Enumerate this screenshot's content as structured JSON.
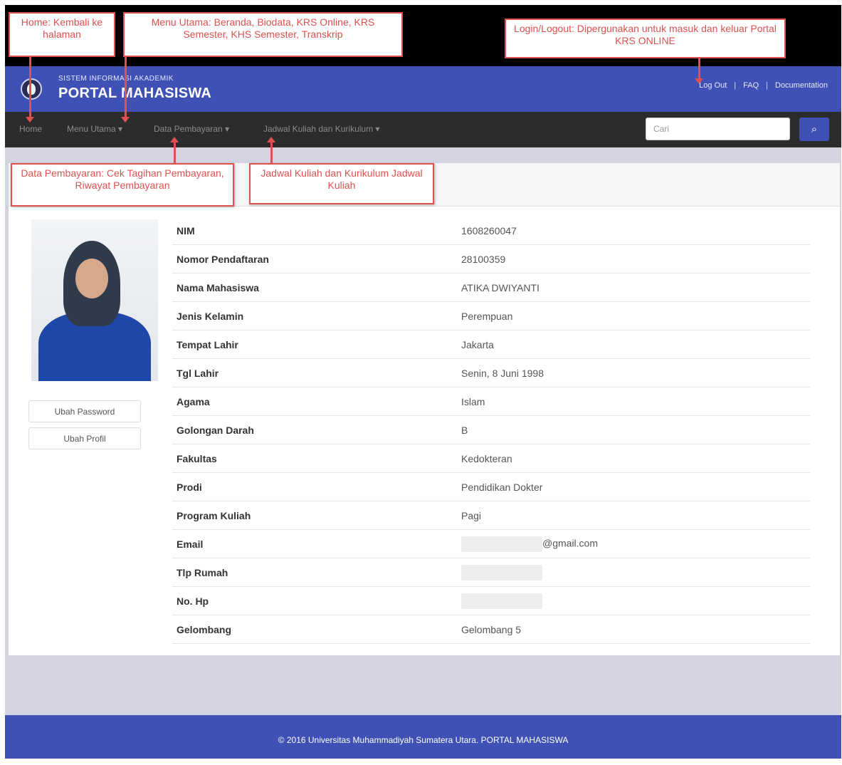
{
  "header": {
    "subtitle": "SISTEM INFORMASI AKADEMIK",
    "title": "PORTAL MAHASISWA",
    "links": [
      "Log Out",
      "FAQ",
      "Documentation"
    ]
  },
  "nav": {
    "items": [
      "Home",
      "Menu Utama",
      "Data Pembayaran",
      "Jadwal Kuliah dan Kurikulum"
    ],
    "search_placeholder": "Cari"
  },
  "annotations": {
    "home": "Home: Kembali ke halaman",
    "menu": "Menu Utama: Beranda, Biodata, KRS Online, KRS Semester, KHS Semester, Transkrip",
    "login": "Login/Logout: Dipergunakan untuk masuk dan keluar Portal KRS ONLINE",
    "pembayaran": "Data Pembayaran: Cek Tagihan Pembayaran, Riwayat Pembayaran",
    "jadwal": "Jadwal Kuliah dan Kurikulum Jadwal Kuliah"
  },
  "buttons": {
    "password": "Ubah Password",
    "profil": "Ubah Profil"
  },
  "profile": [
    {
      "label": "NIM",
      "value": "1608260047"
    },
    {
      "label": "Nomor Pendaftaran",
      "value": "28100359"
    },
    {
      "label": "Nama Mahasiswa",
      "value": "ATIKA DWIYANTI"
    },
    {
      "label": "Jenis Kelamin",
      "value": "Perempuan"
    },
    {
      "label": "Tempat Lahir",
      "value": "Jakarta"
    },
    {
      "label": "Tgl Lahir",
      "value": "Senin, 8 Juni 1998"
    },
    {
      "label": "Agama",
      "value": "Islam"
    },
    {
      "label": "Golongan Darah",
      "value": "B"
    },
    {
      "label": "Fakultas",
      "value": "Kedokteran"
    },
    {
      "label": "Prodi",
      "value": "Pendidikan Dokter"
    },
    {
      "label": "Program Kuliah",
      "value": "Pagi"
    },
    {
      "label": "Email",
      "value": "@gmail.com"
    },
    {
      "label": "Tlp Rumah",
      "value": ""
    },
    {
      "label": "No. Hp",
      "value": ""
    },
    {
      "label": "Gelombang",
      "value": "Gelombang 5"
    }
  ],
  "footer": "© 2016 Universitas Muhammadiyah Sumatera Utara. PORTAL MAHASISWA"
}
